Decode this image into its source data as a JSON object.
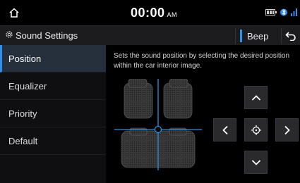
{
  "status": {
    "time": "00:00",
    "ampm": "AM"
  },
  "titlebar": {
    "title": "Sound Settings",
    "beep_label": "Beep"
  },
  "sidebar": {
    "items": [
      {
        "label": "Position"
      },
      {
        "label": "Equalizer"
      },
      {
        "label": "Priority"
      },
      {
        "label": "Default"
      }
    ],
    "active_index": 0
  },
  "content": {
    "description": "Sets the sound position by selecting the desired position within the car interior image."
  },
  "colors": {
    "accent": "#2f8ff0",
    "crosshair": "#2d8fe0"
  },
  "icons": [
    "home-icon",
    "settings-gear-icon",
    "back-arrow-icon",
    "battery-icon",
    "bluetooth-icon",
    "signal-icon",
    "chevron-up-icon",
    "chevron-down-icon",
    "chevron-left-icon",
    "chevron-right-icon",
    "center-target-icon"
  ]
}
